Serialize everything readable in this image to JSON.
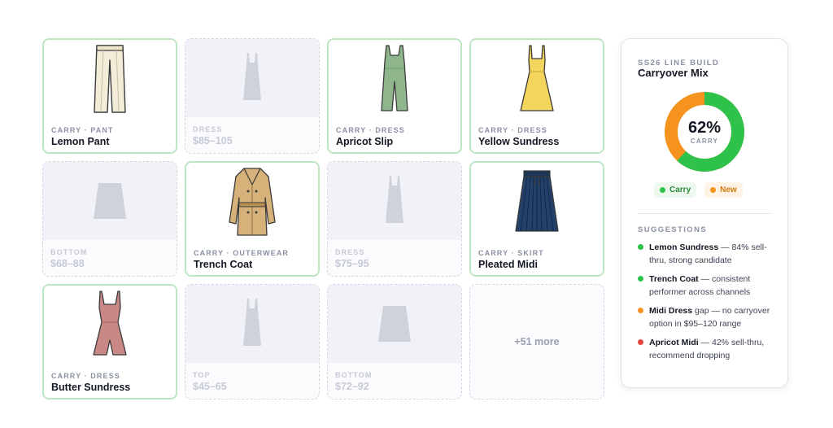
{
  "colors": {
    "carry": "#2ec24a",
    "new": "#f5931e",
    "drop": "#e5453c",
    "carry_border": "#bfe6c3",
    "placeholder": "#cfd1db"
  },
  "grid": {
    "cards": [
      {
        "kind": "filled",
        "icon": "pant-icon",
        "meta": "CARRY · PANT",
        "name": "Lemon Pant"
      },
      {
        "kind": "ghost",
        "icon": "dress-placeholder-icon",
        "meta": "DRESS",
        "name": "$85–105"
      },
      {
        "kind": "filled",
        "icon": "jumpsuit-icon",
        "meta": "CARRY · DRESS",
        "name": "Apricot Slip"
      },
      {
        "kind": "filled",
        "icon": "sundress-icon",
        "meta": "CARRY · DRESS",
        "name": "Yellow Sundress"
      },
      {
        "kind": "ghost",
        "icon": "skirt-placeholder-icon",
        "meta": "BOTTOM",
        "name": "$68–88"
      },
      {
        "kind": "filled",
        "icon": "trench-coat-icon",
        "meta": "CARRY · OUTERWEAR",
        "name": "Trench Coat"
      },
      {
        "kind": "ghost",
        "icon": "dress-placeholder-icon",
        "meta": "DRESS",
        "name": "$75–95"
      },
      {
        "kind": "filled",
        "icon": "pleated-skirt-icon",
        "meta": "CARRY · SKIRT",
        "name": "Pleated Midi"
      },
      {
        "kind": "filled",
        "icon": "romper-icon",
        "meta": "CARRY · DRESS",
        "name": "Butter Sundress"
      },
      {
        "kind": "ghost",
        "icon": "dress-placeholder-icon",
        "meta": "TOP",
        "name": "$45–65"
      },
      {
        "kind": "ghost",
        "icon": "skirt-placeholder-icon",
        "meta": "BOTTOM",
        "name": "$72–92"
      },
      {
        "kind": "more",
        "label": "+51 more"
      }
    ]
  },
  "panel": {
    "eyebrow": "SS26 LINE BUILD",
    "title": "Carryover Mix",
    "donut": {
      "carry_fraction": 0.62,
      "percent_label": "62%",
      "center_label": "CARRY"
    },
    "legend": [
      {
        "label": "Carry"
      },
      {
        "label": "New"
      }
    ],
    "suggestions_heading": "SUGGESTIONS",
    "suggestions": [
      {
        "status": "carry",
        "strong": "Lemon Sundress",
        "rest": " — 84% sell-thru, strong candidate"
      },
      {
        "status": "carry",
        "strong": "Trench Coat",
        "rest": " — consistent performer across channels"
      },
      {
        "status": "new",
        "strong": "Midi Dress",
        "rest": " gap — no carryover option in $95–120 range"
      },
      {
        "status": "drop",
        "strong": "Apricot Midi",
        "rest": " — 42% sell-thru, recommend dropping"
      }
    ]
  }
}
